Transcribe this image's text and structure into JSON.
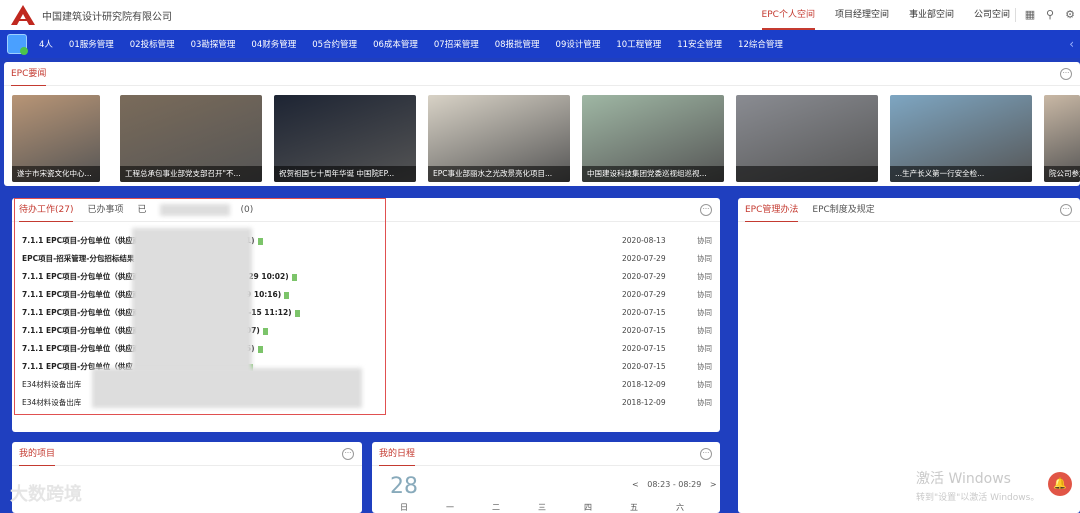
{
  "header": {
    "company": "中国建筑设计研究院有限公司",
    "nav": [
      "EPC个人空间",
      "项目经理空间",
      "事业部空间",
      "公司空间"
    ],
    "active_index": 0
  },
  "bluenav": {
    "count_label": "4人",
    "items": [
      "01服务管理",
      "02投标管理",
      "03勘探管理",
      "04财务管理",
      "05合约管理",
      "06成本管理",
      "07招采管理",
      "08报批管理",
      "09设计管理",
      "10工程管理",
      "11安全管理",
      "12综合管理"
    ]
  },
  "news": {
    "tab": "EPC要闻",
    "items": [
      {
        "caption": "遂宁市宋瓷文化中心...",
        "color": "#b89576"
      },
      {
        "caption": "工程总承包事业部党支部召开\"不...",
        "color": "#7a6b5a"
      },
      {
        "caption": "祝贺祖国七十周年华诞 中国院EP...",
        "color": "#1d2433"
      },
      {
        "caption": "EPC事业部丽水之光改景亮化项目...",
        "color": "#d8d2c6"
      },
      {
        "caption": "中国建设科技集团党委巡视组巡视...",
        "color": "#9fb7a4"
      },
      {
        "caption": "",
        "color": "#8a8c92"
      },
      {
        "caption": "...生产长义第一行安全检...",
        "color": "#7ea6c2"
      },
      {
        "caption": "院公司参加...",
        "color": "#c9b8a5"
      }
    ]
  },
  "todo": {
    "tabs": [
      "待办工作(27)",
      "已办事项",
      "已",
      "(0)"
    ],
    "rows": [
      {
        "title": "7.1.1 EPC项目-分包单位（供应商）",
        "tail": ":21)",
        "date": "2020-08-13",
        "type": "协同",
        "bold": true
      },
      {
        "title": "EPC项目-招采管理-分包招标结果",
        "tail": "",
        "date": "2020-07-29",
        "type": "协同",
        "bold": true
      },
      {
        "title": "7.1.1 EPC项目-分包单位（供应商）入",
        "tail": "-29 10:02)",
        "date": "2020-07-29",
        "type": "协同",
        "bold": true
      },
      {
        "title": "7.1.1 EPC项目-分包单位（供应商）",
        "tail": "-29 10:16)",
        "date": "2020-07-29",
        "type": "协同",
        "bold": true
      },
      {
        "title": "7.1.1 EPC项目-分包单位（供应商）",
        "tail": "07-15 11:12)",
        "date": "2020-07-15",
        "type": "协同",
        "bold": true
      },
      {
        "title": "7.1.1 EPC项目-分包单位（供应商）",
        "tail": "1:07)",
        "date": "2020-07-15",
        "type": "协同",
        "bold": true
      },
      {
        "title": "7.1.1 EPC项目-分包单位（供应商）",
        "tail": ":15)",
        "date": "2020-07-15",
        "type": "协同",
        "bold": true
      },
      {
        "title": "7.1.1 EPC项目-分包单位（供应",
        "tail": "1:20)",
        "date": "2020-07-15",
        "type": "协同",
        "bold": true
      },
      {
        "title": "E34材料设备出库",
        "tail": "",
        "date": "2018-12-09",
        "type": "协同",
        "bold": false
      },
      {
        "title": "E34材料设备出库",
        "tail": "",
        "date": "2018-12-09",
        "type": "协同",
        "bold": false
      }
    ]
  },
  "mgmt": {
    "tabs": [
      "EPC管理办法",
      "EPC制度及规定"
    ]
  },
  "projects": {
    "tab": "我的项目"
  },
  "schedule": {
    "tab": "我的日程",
    "day": "28",
    "range": "08:23 - 08:29",
    "weekdays": [
      "日",
      "一",
      "二",
      "三",
      "四",
      "五",
      "六"
    ]
  },
  "watermark": {
    "line1": "激活 Windows",
    "line2": "转到\"设置\"以激活 Windows。",
    "brand": "大数跨境"
  }
}
